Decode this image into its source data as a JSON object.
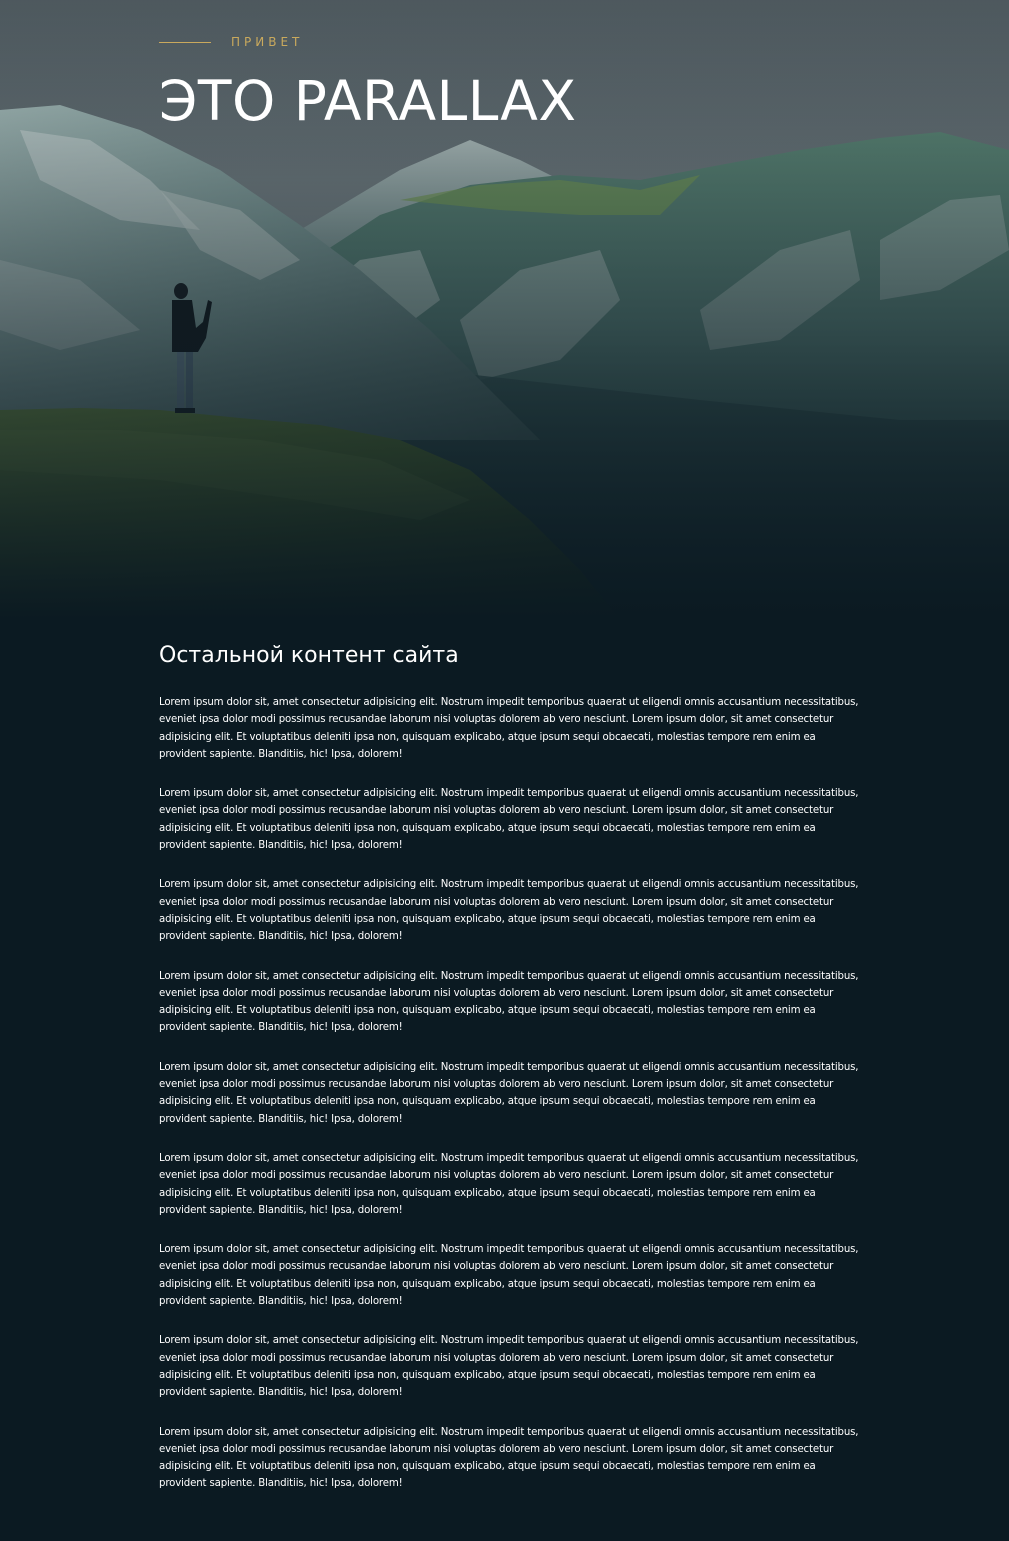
{
  "hero": {
    "eyebrow": "ПРИВЕТ",
    "title": "ЭТО PARALLAX",
    "accent_color": "#c9a95d"
  },
  "content": {
    "heading": "Остальной контент сайта",
    "paragraphs": [
      "Lorem ipsum dolor sit, amet consectetur adipisicing elit. Nostrum impedit temporibus quaerat ut eligendi omnis accusantium necessitatibus, eveniet ipsa dolor modi possimus recusandae laborum nisi voluptas dolorem ab vero nesciunt. Lorem ipsum dolor, sit amet consectetur adipisicing elit. Et voluptatibus deleniti ipsa non, quisquam explicabo, atque ipsum sequi obcaecati, molestias tempore rem enim ea provident sapiente. Blanditiis, hic! Ipsa, dolorem!",
      "Lorem ipsum dolor sit, amet consectetur adipisicing elit. Nostrum impedit temporibus quaerat ut eligendi omnis accusantium necessitatibus, eveniet ipsa dolor modi possimus recusandae laborum nisi voluptas dolorem ab vero nesciunt. Lorem ipsum dolor, sit amet consectetur adipisicing elit. Et voluptatibus deleniti ipsa non, quisquam explicabo, atque ipsum sequi obcaecati, molestias tempore rem enim ea provident sapiente. Blanditiis, hic! Ipsa, dolorem!",
      "Lorem ipsum dolor sit, amet consectetur adipisicing elit. Nostrum impedit temporibus quaerat ut eligendi omnis accusantium necessitatibus, eveniet ipsa dolor modi possimus recusandae laborum nisi voluptas dolorem ab vero nesciunt. Lorem ipsum dolor, sit amet consectetur adipisicing elit. Et voluptatibus deleniti ipsa non, quisquam explicabo, atque ipsum sequi obcaecati, molestias tempore rem enim ea provident sapiente. Blanditiis, hic! Ipsa, dolorem!",
      "Lorem ipsum dolor sit, amet consectetur adipisicing elit. Nostrum impedit temporibus quaerat ut eligendi omnis accusantium necessitatibus, eveniet ipsa dolor modi possimus recusandae laborum nisi voluptas dolorem ab vero nesciunt. Lorem ipsum dolor, sit amet consectetur adipisicing elit. Et voluptatibus deleniti ipsa non, quisquam explicabo, atque ipsum sequi obcaecati, molestias tempore rem enim ea provident sapiente. Blanditiis, hic! Ipsa, dolorem!",
      "Lorem ipsum dolor sit, amet consectetur adipisicing elit. Nostrum impedit temporibus quaerat ut eligendi omnis accusantium necessitatibus, eveniet ipsa dolor modi possimus recusandae laborum nisi voluptas dolorem ab vero nesciunt. Lorem ipsum dolor, sit amet consectetur adipisicing elit. Et voluptatibus deleniti ipsa non, quisquam explicabo, atque ipsum sequi obcaecati, molestias tempore rem enim ea provident sapiente. Blanditiis, hic! Ipsa, dolorem!",
      "Lorem ipsum dolor sit, amet consectetur adipisicing elit. Nostrum impedit temporibus quaerat ut eligendi omnis accusantium necessitatibus, eveniet ipsa dolor modi possimus recusandae laborum nisi voluptas dolorem ab vero nesciunt. Lorem ipsum dolor, sit amet consectetur adipisicing elit. Et voluptatibus deleniti ipsa non, quisquam explicabo, atque ipsum sequi obcaecati, molestias tempore rem enim ea provident sapiente. Blanditiis, hic! Ipsa, dolorem!",
      "Lorem ipsum dolor sit, amet consectetur adipisicing elit. Nostrum impedit temporibus quaerat ut eligendi omnis accusantium necessitatibus, eveniet ipsa dolor modi possimus recusandae laborum nisi voluptas dolorem ab vero nesciunt. Lorem ipsum dolor, sit amet consectetur adipisicing elit. Et voluptatibus deleniti ipsa non, quisquam explicabo, atque ipsum sequi obcaecati, molestias tempore rem enim ea provident sapiente. Blanditiis, hic! Ipsa, dolorem!",
      "Lorem ipsum dolor sit, amet consectetur adipisicing elit. Nostrum impedit temporibus quaerat ut eligendi omnis accusantium necessitatibus, eveniet ipsa dolor modi possimus recusandae laborum nisi voluptas dolorem ab vero nesciunt. Lorem ipsum dolor, sit amet consectetur adipisicing elit. Et voluptatibus deleniti ipsa non, quisquam explicabo, atque ipsum sequi obcaecati, molestias tempore rem enim ea provident sapiente. Blanditiis, hic! Ipsa, dolorem!",
      "Lorem ipsum dolor sit, amet consectetur adipisicing elit. Nostrum impedit temporibus quaerat ut eligendi omnis accusantium necessitatibus, eveniet ipsa dolor modi possimus recusandae laborum nisi voluptas dolorem ab vero nesciunt. Lorem ipsum dolor, sit amet consectetur adipisicing elit. Et voluptatibus deleniti ipsa non, quisquam explicabo, atque ipsum sequi obcaecati, molestias tempore rem enim ea provident sapiente. Blanditiis, hic! Ipsa, dolorem!"
    ]
  }
}
